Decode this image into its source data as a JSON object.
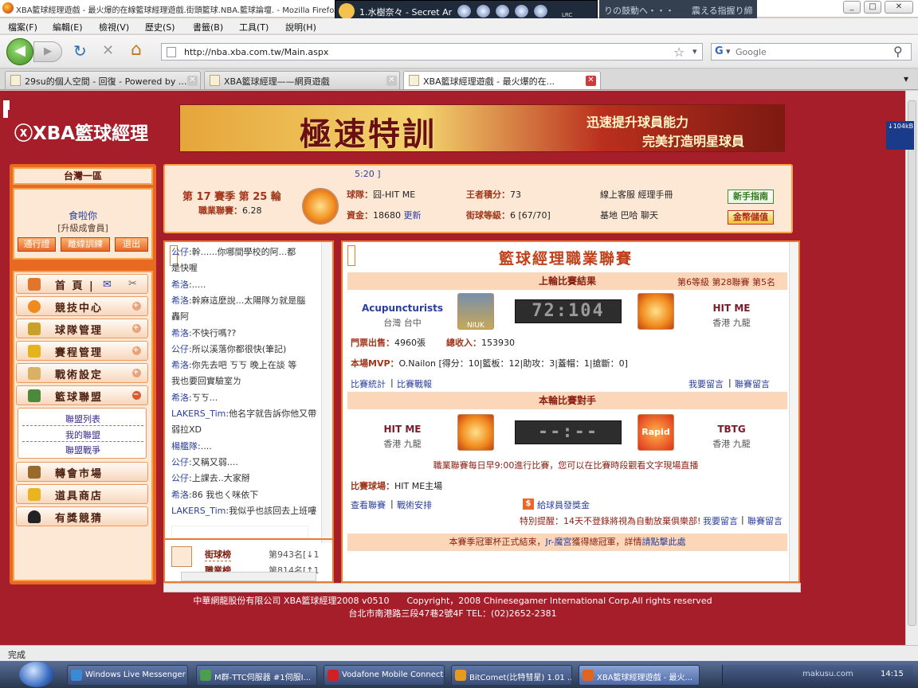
{
  "window": {
    "title": "XBA籃球經理遊戲 - 最火爆的在線籃球經理遊戲.街頭籃球.NBA.籃球論壇. - Mozilla Firefox",
    "player_title": "1.水樹奈々 - Secret Ar",
    "player_tag": "LRC",
    "lyric_text": "りの鼓動へ・・・　　震える指握り締",
    "minimize": "_",
    "maximize": "□",
    "close": "✕"
  },
  "menu": [
    "檔案(F)",
    "編輯(E)",
    "檢視(V)",
    "歷史(S)",
    "書籤(B)",
    "工具(T)",
    "說明(H)"
  ],
  "nav": {
    "url": "http://nba.xba.com.tw/Main.aspx",
    "search_placeholder": "Google",
    "search_engine": "G",
    "back_icon": "◀",
    "forward_icon": "▶",
    "reload_icon": "↻",
    "stop_icon": "✕",
    "home_icon": "⌂",
    "star_icon": "☆",
    "dropdown_icon": "▾",
    "search_icon": "⚲"
  },
  "tabs": [
    {
      "label": "29su的個人空間 - 回復 - Powered by ...",
      "close": "✕"
    },
    {
      "label": "XBA籃球經理——網頁遊戲",
      "close": "✕"
    },
    {
      "label": "XBA籃球經理遊戲 - 最火爆的在...",
      "close": "✕"
    }
  ],
  "tab_menu": "▾",
  "site": {
    "logo": "ⓧXBA籃球經理",
    "banner_big": "極速特訓",
    "banner_sub1": "迅速提升球員能力",
    "banner_sub2": "完美打造明星球員",
    "meter": "↓104kB"
  },
  "left": {
    "server": "台灣一區",
    "username": "食啦你",
    "member_level": "[升級成會員]",
    "btn_pass": "通行證",
    "btn_offline": "離線訓練",
    "btn_logout": "退出",
    "nav": [
      {
        "label": "首 頁 |",
        "icon": "home-icon",
        "color": "#e0762c"
      },
      {
        "label": "競技中心",
        "icon": "basketball-icon",
        "color": "#f08a1c"
      },
      {
        "label": "球隊管理",
        "icon": "clipboard-icon",
        "color": "#c9a02a"
      },
      {
        "label": "賽程管理",
        "icon": "trophy-icon",
        "color": "#e5b31a"
      },
      {
        "label": "戰術設定",
        "icon": "tactics-icon",
        "color": "#d8b264"
      },
      {
        "label": "籃球聯盟",
        "icon": "group-icon",
        "color": "#4a8a3a"
      },
      {
        "label": "轉會市場",
        "icon": "hammer-icon",
        "color": "#9a6a2a"
      },
      {
        "label": "道具商店",
        "icon": "shop-icon",
        "color": "#e8b520"
      },
      {
        "label": "有獎競猜",
        "icon": "spade-icon",
        "color": "#222222"
      }
    ],
    "plus": "+",
    "minus": "−",
    "league_links": [
      "聯盟列表",
      "我的聯盟",
      "聯盟戰爭"
    ]
  },
  "info": {
    "time": "5:20 ]",
    "season": "第 17 賽季 第 25 輪",
    "league_label": "職業聯賽：",
    "league_value": "6.28",
    "team_label": "球隊：",
    "team_value": "囧-HIT ME",
    "funds_label": "資金：",
    "funds_value": "18680",
    "refresh": "更新",
    "king_label": "王者積分：",
    "king_value": "73",
    "street_label": "街球等級：",
    "street_value": "6 [67/70]",
    "links1": "線上客服  經理手冊",
    "links2": "基地  巴哈  聊天",
    "newbie": "新手指南",
    "gold": "金幣儲值"
  },
  "chat": {
    "lines": [
      {
        "name": "公仔",
        "text": ":幹......你哪間學校的阿...都"
      },
      {
        "name": "",
        "text": "是快喔"
      },
      {
        "name": "希洛",
        "text": ":....."
      },
      {
        "name": "希洛",
        "text": ":幹麻這麼說...太陽隊ㄉ就是腦"
      },
      {
        "name": "",
        "text": "轟阿"
      },
      {
        "name": "希洛",
        "text": ":不快行嗎??"
      },
      {
        "name": "公仔",
        "text": ":所以溪落你都很快(筆記)"
      },
      {
        "name": "希洛",
        "text": ":你先去吧 ㄎㄎ 晚上在談 等"
      },
      {
        "name": "",
        "text": "我也要回實驗室ㄌ"
      },
      {
        "name": "希洛",
        "text": ":ㄎㄎ..."
      },
      {
        "name": "LAKERS_Tim",
        "text": ":他名字就告訴你他又帶"
      },
      {
        "name": "",
        "text": "弱拉XD"
      },
      {
        "name": "楊艦隊",
        "text": ":...."
      },
      {
        "name": "公仔",
        "text": ":又稱又弱...."
      },
      {
        "name": "公仔",
        "text": ":上課去..大家掰"
      },
      {
        "name": "希洛",
        "text": ":86 我也ㄑ咪依下"
      },
      {
        "name": "LAKERS_Tim",
        "text": ":我似乎也該回去上班嘍"
      }
    ],
    "rank1_label": "街球榜",
    "rank1_value": "第943名[↓1",
    "rank2_label": "職業榜",
    "rank2_value": "第814名[↑1"
  },
  "main": {
    "title": "籃球經理職業聯賽",
    "last_result": "上輪比賽結果",
    "league_rank": "第6等級 第28聯賽 第5名",
    "home_team": "Acupuncturists",
    "home_loc": "台灣 台中",
    "home_logo": "NIUK",
    "score": "72:104",
    "away_team": "HIT ME",
    "away_loc": "香港 九龍",
    "tickets_label": "門票出售：",
    "tickets_value": "4960張",
    "income_label": "總收入：",
    "income_value": "153930",
    "mvp_label": "本場MVP：",
    "mvp_value": "O.Nailon [得分：10|籃板：12|助攻：3|蓋帽：1|搶斷：0]",
    "link_stats": "比賽統計",
    "link_report": "比賽戰報",
    "link_comment": "我要留言",
    "link_league_comment": "聯賽留言",
    "next_opponent": "本輪比賽對手",
    "next_home": "HIT ME",
    "next_home_loc": "香港 九龍",
    "next_score": "--:--",
    "next_away": "TBTG",
    "next_away_loc": "香港 九龍",
    "next_away_logo": "Rapid",
    "schedule_note": "職業聯賽每日早9:00進行比賽，您可以在比賽時段觀看文字現場直播",
    "court_label": "比賽球場：",
    "court_value": "HIT ME主場",
    "link_view": "查看聯賽",
    "link_tactics": "戰術安排",
    "bonus": "給球員發獎金",
    "bonus_icon": "$",
    "warning": "特別提醒：14天不登錄將視為自動放棄俱樂部!",
    "banner_pre": "本賽季冠軍杯正式結束，",
    "banner_link": "Jr-魔宮",
    "banner_mid": "獲得總冠軍，詳情",
    "banner_link2": "請點擊此處"
  },
  "footer": {
    "line1": "中華網龍股份有限公司 XBA籃球經理2008 v0510　　Copyright，2008 Chinesegamer International Corp.All rights reserved",
    "line2": "台北市南港路三段47巷2號4F TEL：(02)2652-2381"
  },
  "status": "完成",
  "taskbar": {
    "items": [
      {
        "label": "Windows Live Messenger",
        "color": "#3a8ad8"
      },
      {
        "label": "M群-TTC伺服器 #1伺服I...",
        "color": "#4aa04a"
      },
      {
        "label": "Vodafone Mobile Connect ...",
        "color": "#d02020"
      },
      {
        "label": "BitComet(比特彗星) 1.01 ...",
        "color": "#e89a20"
      },
      {
        "label": "XBA籃球經理遊戲 - 最火...",
        "color": "#e0651a"
      }
    ],
    "clock": "14:15",
    "watermark": "makusu.com"
  }
}
